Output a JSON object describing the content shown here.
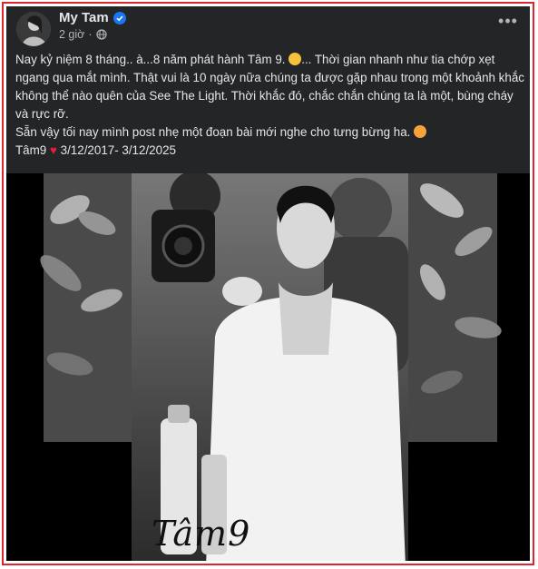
{
  "post": {
    "author": "My Tam",
    "time": "2 giờ",
    "more_label": "•••",
    "lines": [
      "Nay kỷ niệm 8 tháng.. à...8 năm phát hành Tâm 9.",
      "... Thời gian nhanh như tia chớp xẹt ngang qua mắt mình. Thật vui là 10 ngày nữa chúng ta được gặp nhau trong một khoảnh khắc không thể nào quên của See The Light. Thời khắc đó, chắc chắn chúng ta là một, bùng cháy và rực rỡ.",
      "Sẵn vậy tối nay mình post nhẹ một đoạn bài mới nghe cho tưng bừng ha.",
      "Tâm9",
      " 3/12/2017- 3/12/2025"
    ],
    "heart": "♥"
  },
  "photo": {
    "signature": "Tâm9"
  },
  "colors": {
    "card_bg": "#242526",
    "text": "#e4e6eb",
    "secondary": "#b0b3b8",
    "verified": "#1877f2",
    "frame": "#e0232d"
  }
}
